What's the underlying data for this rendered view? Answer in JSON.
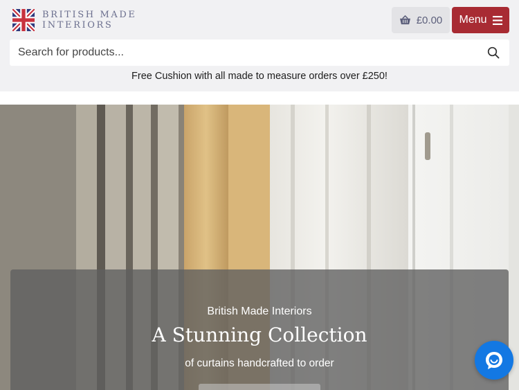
{
  "header": {
    "brand_line1": "BRITISH MADE",
    "brand_line2": "INTERIORS",
    "basket_total": "£0.00",
    "menu_label": "Menu"
  },
  "search": {
    "placeholder": "Search for products..."
  },
  "promo": {
    "text": "Free Cushion with all made to measure orders over £250!"
  },
  "hero": {
    "kicker": "British Made Interiors",
    "headline": "A Stunning Collection",
    "subtext": "of curtains handcrafted to order"
  },
  "icons": [
    "union-jack-logo-icon",
    "basket-icon",
    "hamburger-icon",
    "search-icon",
    "chat-icon"
  ],
  "colors": {
    "topbar_bg": "#f1f1f3",
    "menu_bg": "#a82b33",
    "brand_text": "#6b6f8e",
    "chat_bg": "#1378e3"
  }
}
